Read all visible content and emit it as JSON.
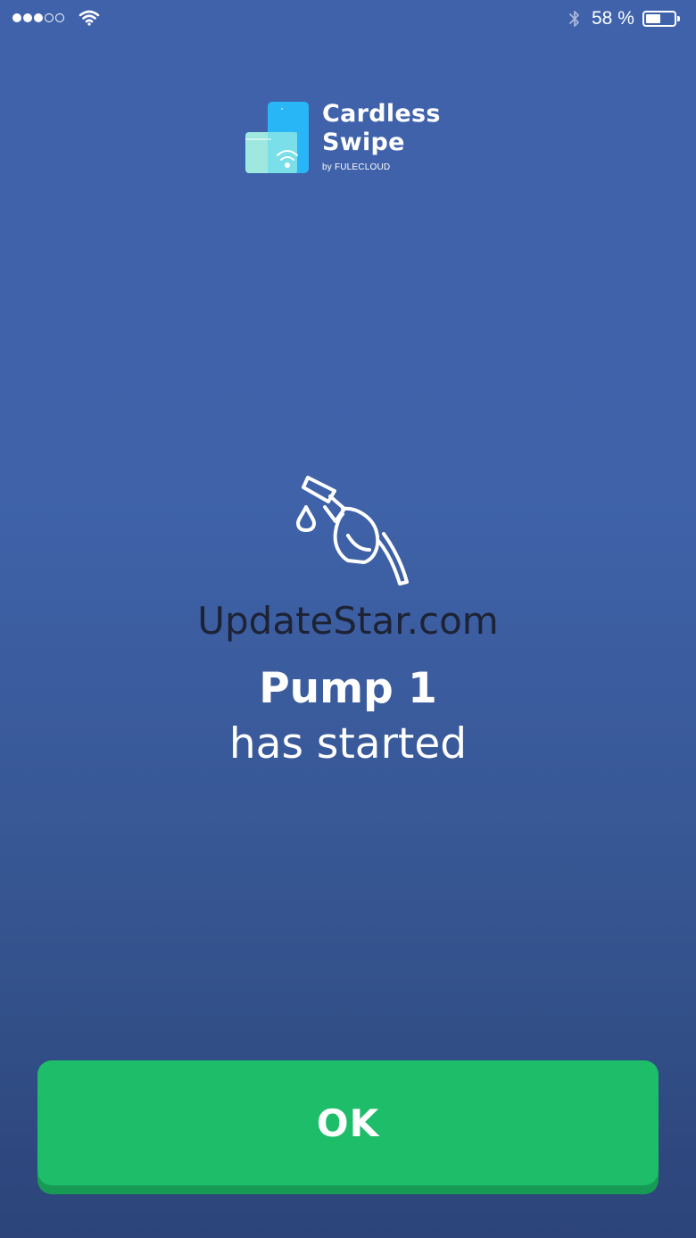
{
  "status_bar": {
    "signal_bars_filled": 3,
    "signal_bars_total": 5,
    "wifi_icon": "wifi-icon",
    "bluetooth_icon": "bluetooth-icon",
    "battery_text": "58 %",
    "battery_level": 0.58
  },
  "logo": {
    "line1": "Cardless",
    "line2": "Swipe",
    "byline": "by FULECLOUD",
    "icon": "cardless-swipe-logo-icon"
  },
  "content": {
    "icon": "fuel-nozzle-icon",
    "watermark": "UpdateStar.com",
    "title": "Pump 1",
    "status": "has started"
  },
  "actions": {
    "ok_label": "OK"
  },
  "colors": {
    "background_top": "#3f62ab",
    "background_bottom": "#2c4479",
    "button": "#1dbd6a",
    "button_shadow": "#179a54",
    "logo_blue": "#29b6f6",
    "logo_mint": "#a7f3e4"
  }
}
